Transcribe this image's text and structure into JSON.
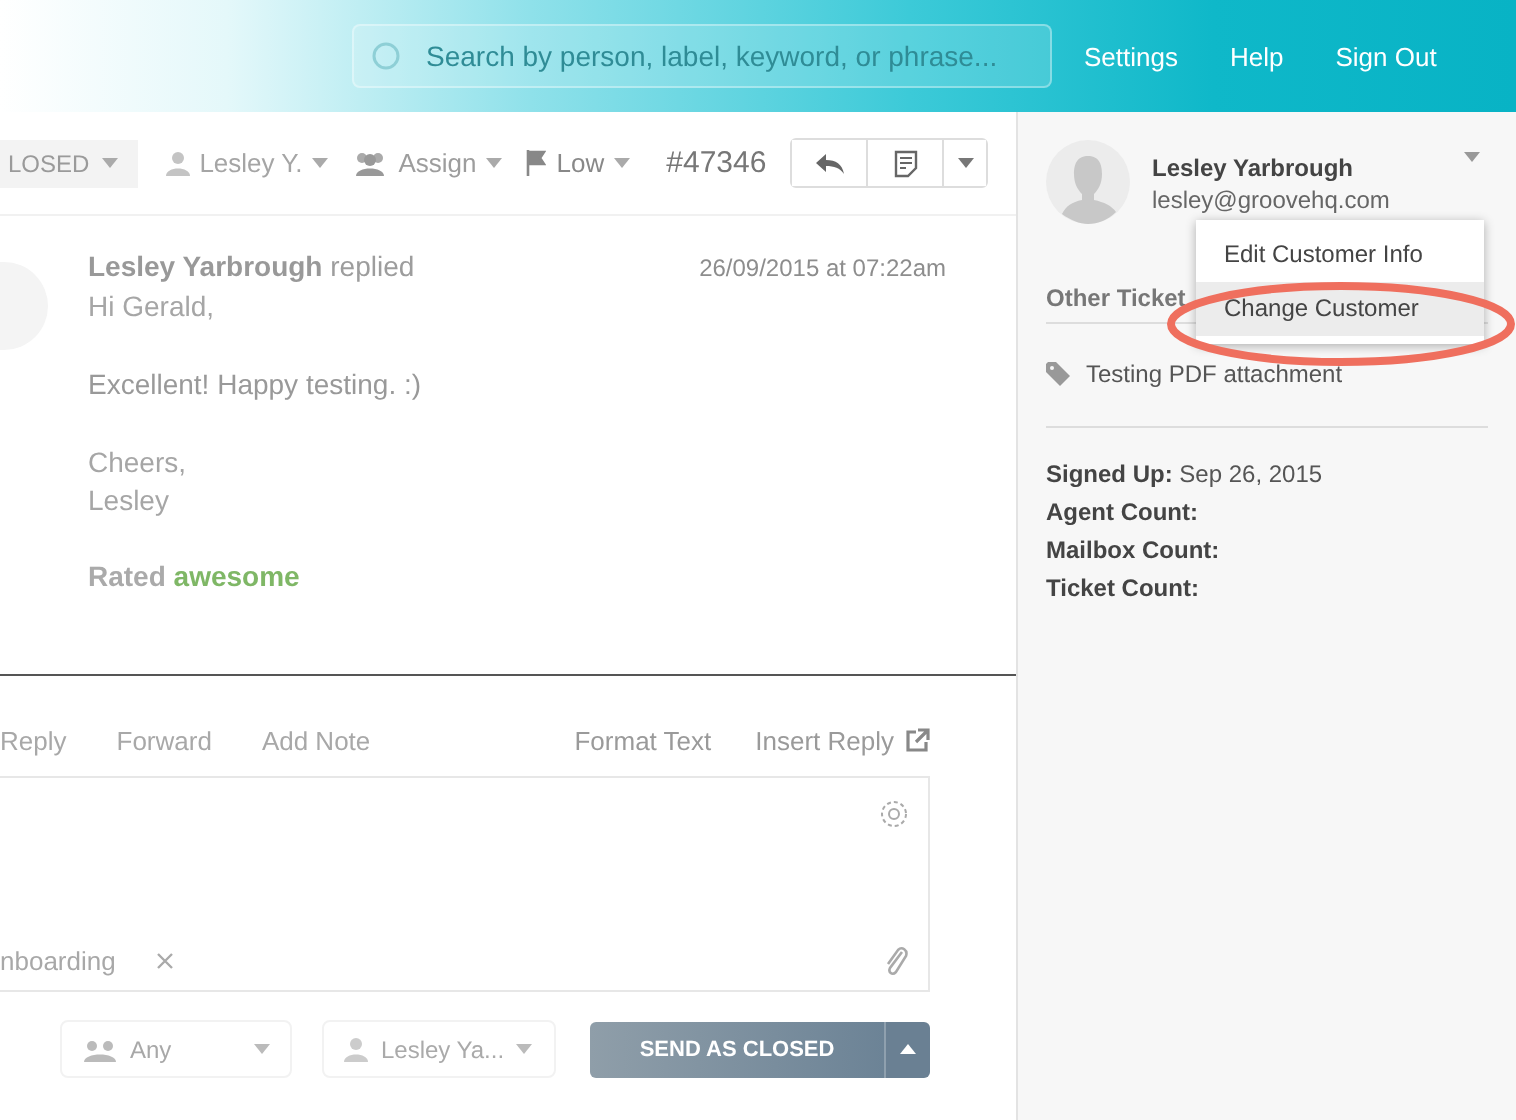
{
  "top_bar": {
    "search": {
      "placeholder": "Search by person, label, keyword, or phrase..."
    },
    "links": [
      "Settings",
      "Help",
      "Sign Out"
    ]
  },
  "toolbar": {
    "status": "LOSED",
    "assignee": "Lesley Y.",
    "group": "Assign",
    "priority": "Low",
    "ticket_number": "#47346"
  },
  "message": {
    "author": "Lesley Yarbrough",
    "action": "replied",
    "time": "26/09/2015 at 07:22am",
    "paragraphs": [
      [
        "Hi Gerald,"
      ],
      [
        "Excellent! Happy testing. :)"
      ],
      [
        "Cheers,",
        "Lesley"
      ]
    ],
    "rating_label": "Rated",
    "rating_value": "awesome"
  },
  "composer": {
    "modes": [
      "Reply",
      "Forward",
      "Add Note"
    ],
    "actions": [
      "Format Text",
      "Insert Reply"
    ],
    "tag": "nboarding",
    "group_select": "Any",
    "assignee_select": "Lesley Ya...",
    "send_button": "SEND AS CLOSED"
  },
  "sidebar": {
    "customer": {
      "name": "Lesley Yarbrough",
      "email": "lesley@groovehq.com"
    },
    "menu": [
      {
        "label": "Edit Customer Info",
        "selected": false
      },
      {
        "label": "Change Customer",
        "selected": true
      }
    ],
    "section_title": "Other Ticket",
    "tickets": [
      "Testing PDF attachment"
    ],
    "details": [
      {
        "label": "Signed Up:",
        "value": "Sep 26, 2015"
      },
      {
        "label": "Agent Count:"
      },
      {
        "label": "Mailbox Count:"
      },
      {
        "label": "Ticket Count:"
      }
    ]
  }
}
